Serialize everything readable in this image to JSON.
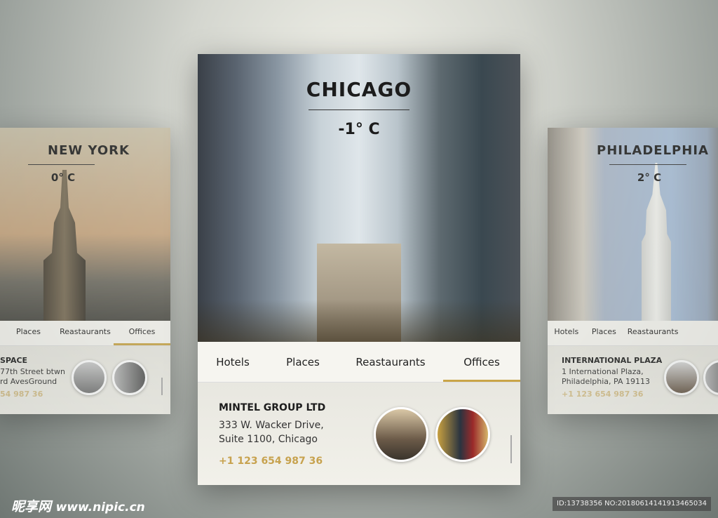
{
  "cards": {
    "new_york": {
      "city": "NEW YORK",
      "temp": "0° C",
      "tabs": [
        "Places",
        "Reastaurants",
        "Offices"
      ],
      "active_tab": "Offices",
      "name": "SPACE",
      "address": [
        "77th Street btwn",
        "rd AvesGround"
      ],
      "phone": "54 987 36"
    },
    "chicago": {
      "city": "CHICAGO",
      "temp": "-1° C",
      "tabs": [
        "Hotels",
        "Places",
        "Reastaurants",
        "Offices"
      ],
      "active_tab": "Offices",
      "name": "MINTEL GROUP LTD",
      "address": [
        "333 W. Wacker Drive,",
        "Suite 1100, Chicago"
      ],
      "phone": "+1 123 654 987 36"
    },
    "philadelphia": {
      "city": "PHILADELPHIA",
      "temp": "2° C",
      "tabs": [
        "Hotels",
        "Places",
        "Reastaurants"
      ],
      "active_tab": "",
      "name": "INTERNATIONAL PLAZA",
      "address": [
        "1 International Plaza,",
        "Philadelphia, PA 19113"
      ],
      "phone": "+1 123 654 987 36"
    }
  },
  "watermark": {
    "logo": "昵享网",
    "url": "www.nipic.cn",
    "id": "ID:13738356 NO:20180614141913465034"
  },
  "colors": {
    "accent": "#c9a548"
  }
}
